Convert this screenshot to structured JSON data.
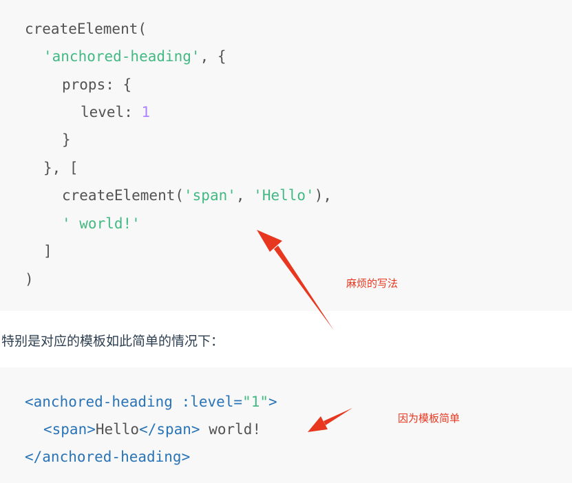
{
  "block1": {
    "l1": "createElement(",
    "l2_s": "'anchored-heading'",
    "l2_r": ", {",
    "l3": "props: {",
    "l4_a": "level: ",
    "l4_n": "1",
    "l5": "}",
    "l6": "}, [",
    "l7_a": "createElement(",
    "l7_s1": "'span'",
    "l7_m": ", ",
    "l7_s2": "'Hello'",
    "l7_e": "),",
    "l8_s": "' world!'",
    "l9": "]",
    "l10": ")"
  },
  "prose": "特别是对应的模板如此简单的情况下：",
  "block2": {
    "l1_tag": "<anchored-heading :level=",
    "l1_val": "\"1\"",
    "l1_end": ">",
    "l2_open": "<span>",
    "l2_text": "Hello",
    "l2_close": "</span>",
    "l2_rest": " world!",
    "l3": "</anchored-heading>"
  },
  "annotations": {
    "a1": "麻烦的写法",
    "a2": "因为模板简单"
  },
  "colors": {
    "code_bg": "#f8f8f8",
    "string": "#42b983",
    "number": "#ae81ff",
    "tag": "#2973b7",
    "annotation": "#e8371f"
  }
}
